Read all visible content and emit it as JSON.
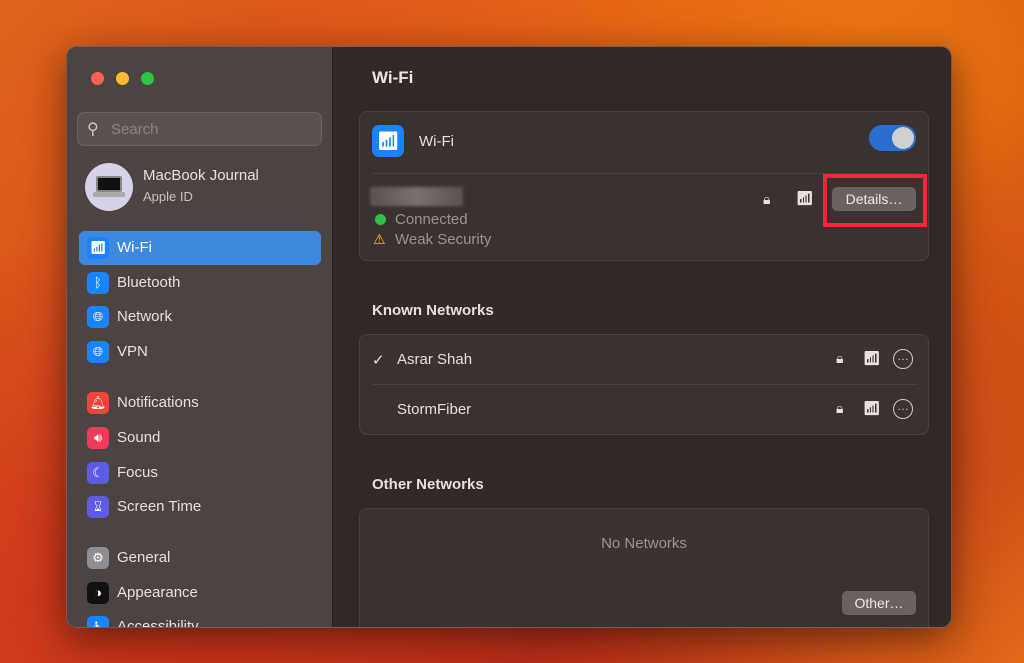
{
  "sidebar": {
    "search_placeholder": "Search",
    "account": {
      "name": "MacBook Journal",
      "subtitle": "Apple ID"
    },
    "items": [
      {
        "label": "Wi-Fi",
        "icon": "wifi-icon",
        "color": "#1a84ff",
        "selected": true
      },
      {
        "label": "Bluetooth",
        "icon": "bluetooth-icon",
        "color": "#1a84ff"
      },
      {
        "label": "Network",
        "icon": "globe-icon",
        "color": "#1a84ff"
      },
      {
        "label": "VPN",
        "icon": "vpn-globe-icon",
        "color": "#1a84ff"
      },
      {
        "label": "Notifications",
        "icon": "bell-icon",
        "color": "#f0433a"
      },
      {
        "label": "Sound",
        "icon": "speaker-icon",
        "color": "#f03a5a"
      },
      {
        "label": "Focus",
        "icon": "moon-icon",
        "color": "#5e5ce6"
      },
      {
        "label": "Screen Time",
        "icon": "hourglass-icon",
        "color": "#5e5ce6"
      },
      {
        "label": "General",
        "icon": "gear-icon",
        "color": "#8e8e93"
      },
      {
        "label": "Appearance",
        "icon": "appearance-icon",
        "color": "#111111"
      },
      {
        "label": "Accessibility",
        "icon": "accessibility-icon",
        "color": "#1a84ff"
      }
    ]
  },
  "main": {
    "title": "Wi-Fi",
    "wifi_label": "Wi-Fi",
    "wifi_enabled": true,
    "current": {
      "status": "Connected",
      "warning": "Weak Security",
      "details_button": "Details…"
    },
    "known_heading": "Known Networks",
    "known": [
      {
        "name": "Asrar Shah",
        "connected": true
      },
      {
        "name": "StormFiber",
        "connected": false
      }
    ],
    "other_heading": "Other Networks",
    "no_networks": "No Networks",
    "other_button": "Other…"
  },
  "colors": {
    "accent": "#3f88e0",
    "highlight": "#f0283c",
    "connected": "#30c048",
    "warning": "#ffc20a"
  }
}
